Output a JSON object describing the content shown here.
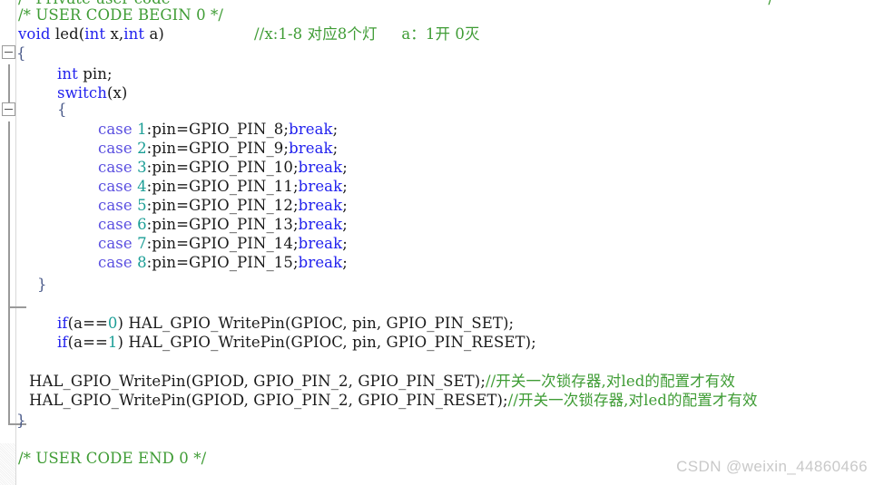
{
  "editor": {
    "language": "C",
    "font_size_px": 16.5,
    "line_height_px": 21,
    "background": "#ffffff",
    "gutter_background": "#f2f2f2",
    "colors": {
      "comment": "#3f9c35",
      "keyword": "#2222ee",
      "keyword_case": "#5a4fe0",
      "number": "#1b9e96",
      "text": "#1a1a1a",
      "fold_marker": "#9a9a9a",
      "watermark": "#c9c9c9"
    }
  },
  "lines": {
    "l0_partial": "/* Private user code",
    "l0_tail": "*/",
    "l1": "/* USER CODE BEGIN 0 */",
    "l2_kw_void": "void",
    "l2_name": " led(",
    "l2_kw_int1": "int",
    "l2_mid": " x,",
    "l2_kw_int2": "int",
    "l2_tail": " a)",
    "l2_comment": "//x:1-8 对应8个灯     a：1开 0灭",
    "l3_brace_open": "{",
    "l4_kw": "int",
    "l4_rest": " pin;",
    "l5_kw": "switch",
    "l5_rest": "(x)",
    "l6_brace_open": "{",
    "l15_brace_close": "}",
    "l17_if_kw": "if",
    "l17_cond_open": "(a==",
    "l17_cond_num": "0",
    "l17_cond_close": ")",
    "l17_call": " HAL_GPIO_WritePin(GPIOC, pin, GPIO_PIN_SET);",
    "l18_if_kw": "if",
    "l18_cond_open": "(a==",
    "l18_cond_num": "1",
    "l18_cond_close": ")",
    "l18_call": " HAL_GPIO_WritePin(GPIOC, pin, GPIO_PIN_RESET);",
    "l20_call": "HAL_GPIO_WritePin(GPIOD, GPIO_PIN_2, GPIO_PIN_SET);",
    "l20_comment": "//开关一次锁存器,对led的配置才有效",
    "l21_call": "HAL_GPIO_WritePin(GPIOD, GPIO_PIN_2, GPIO_PIN_RESET);",
    "l21_comment": "//开关一次锁存器,对led的配置才有效",
    "l22_brace_close": "}",
    "l24": "/* USER CODE END 0 */"
  },
  "switch_cases": [
    {
      "kw": "case",
      "label": "1",
      "body": ":pin=GPIO_PIN_8;",
      "brk": "break",
      "semi": ";"
    },
    {
      "kw": "case",
      "label": "2",
      "body": ":pin=GPIO_PIN_9;",
      "brk": "break",
      "semi": ";"
    },
    {
      "kw": "case",
      "label": "3",
      "body": ":pin=GPIO_PIN_10;",
      "brk": "break",
      "semi": ";"
    },
    {
      "kw": "case",
      "label": "4",
      "body": ":pin=GPIO_PIN_11;",
      "brk": "break",
      "semi": ";"
    },
    {
      "kw": "case",
      "label": "5",
      "body": ":pin=GPIO_PIN_12;",
      "brk": "break",
      "semi": ";"
    },
    {
      "kw": "case",
      "label": "6",
      "body": ":pin=GPIO_PIN_13;",
      "brk": "break",
      "semi": ";"
    },
    {
      "kw": "case",
      "label": "7",
      "body": ":pin=GPIO_PIN_14;",
      "brk": "break",
      "semi": ";"
    },
    {
      "kw": "case",
      "label": "8",
      "body": ":pin=GPIO_PIN_15;",
      "brk": "break",
      "semi": ";"
    }
  ],
  "fold_markers": [
    {
      "name": "fold-function-body",
      "state": "expanded",
      "glyph": "minus"
    },
    {
      "name": "fold-switch-body",
      "state": "expanded",
      "glyph": "minus"
    }
  ],
  "watermark": {
    "text": "CSDN @weixin_44860466"
  }
}
